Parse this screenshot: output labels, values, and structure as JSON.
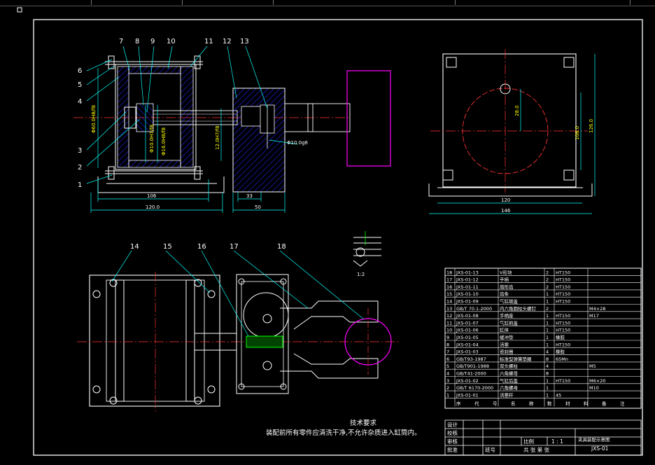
{
  "views": {
    "front_labels": [
      "1",
      "2",
      "3",
      "4",
      "5",
      "6",
      "7",
      "8",
      "9",
      "10",
      "11",
      "12",
      "13"
    ],
    "plan_labels": [
      "14",
      "15",
      "16",
      "17",
      "18"
    ],
    "dims": {
      "d106": "106",
      "d120": "120.0",
      "d33": "33",
      "d50": "50",
      "d120r": "120",
      "d146": "146",
      "d28": "28.0",
      "d108": "108.0",
      "d126": "126.0",
      "phi10g6": "Φ10.0g6",
      "phi60": "Φ60.0H8/f8",
      "phi10h7": "Φ10.0H7/f8",
      "phi16h8": "Φ16.0H8/f8",
      "d12h7": "12.0H7/f8"
    },
    "detail_scale": "1:2"
  },
  "bom": {
    "rows": [
      {
        "no": "18",
        "code": "JXS-01-13",
        "name": "V形块",
        "qty": "2",
        "mat": "HT150",
        "note": ""
      },
      {
        "no": "17",
        "code": "JXS-01-12",
        "name": "手柄",
        "qty": "2",
        "mat": "HT150",
        "note": ""
      },
      {
        "no": "16",
        "code": "JXS-01-11",
        "name": "扇形齿",
        "qty": "2",
        "mat": "HT150",
        "note": ""
      },
      {
        "no": "15",
        "code": "JXS-01-10",
        "name": "齿条",
        "qty": "1",
        "mat": "HT150",
        "note": ""
      },
      {
        "no": "14",
        "code": "JXS-01-09",
        "name": "气缸端盖",
        "qty": "1",
        "mat": "HT150",
        "note": ""
      },
      {
        "no": "13",
        "code": "GB/T 70.1-2000",
        "name": "内六角圆柱头螺钉",
        "qty": "2",
        "mat": "",
        "note": "M4×28"
      },
      {
        "no": "12",
        "code": "JXS-01-08",
        "name": "手柄座",
        "qty": "1",
        "mat": "HT150",
        "note": "M17"
      },
      {
        "no": "11",
        "code": "JXS-01-07",
        "name": "气缸前盖",
        "qty": "1",
        "mat": "HT150",
        "note": ""
      },
      {
        "no": "10",
        "code": "JXS-01-06",
        "name": "缸体",
        "qty": "1",
        "mat": "HT150",
        "note": ""
      },
      {
        "no": "9",
        "code": "JXS-01-05",
        "name": "缓冲垫",
        "qty": "1",
        "mat": "橡胶",
        "note": ""
      },
      {
        "no": "8",
        "code": "JXS-01-04",
        "name": "活塞",
        "qty": "1",
        "mat": "HT150",
        "note": ""
      },
      {
        "no": "7",
        "code": "JXS-01-03",
        "name": "密封圈",
        "qty": "4",
        "mat": "橡胶",
        "note": ""
      },
      {
        "no": "6",
        "code": "GB/T93-1987",
        "name": "标准型弹簧垫圈",
        "qty": "8",
        "mat": "65Mn",
        "note": ""
      },
      {
        "no": "5",
        "code": "GB/T901-1988",
        "name": "双头螺柱",
        "qty": "4",
        "mat": "",
        "note": "M5"
      },
      {
        "no": "4",
        "code": "GB/T41-2000",
        "name": "六角螺母",
        "qty": "8",
        "mat": "",
        "note": ""
      },
      {
        "no": "3",
        "code": "JXS-01-02",
        "name": "气缸后盖",
        "qty": "1",
        "mat": "HT150",
        "note": "M6×20"
      },
      {
        "no": "2",
        "code": "GB/T 6170-2000",
        "name": "六角螺母",
        "qty": "1",
        "mat": "",
        "note": "M10"
      },
      {
        "no": "1",
        "code": "JXS-01-01",
        "name": "活塞杆",
        "qty": "1",
        "mat": "45",
        "note": ""
      }
    ],
    "header_glyphs": [
      "序",
      "代",
      "号",
      "名",
      "称",
      "数",
      "材",
      "料",
      "备",
      "注"
    ]
  },
  "notes": {
    "title": "技术要求",
    "line1": "装配前所有零件应清洗干净,不允许杂质进入缸筒内。"
  },
  "titleblock": {
    "design": "设计",
    "check": "校核",
    "review": "审核",
    "approve": "批准",
    "scale_label": "比例",
    "scale_value": "1 : 1",
    "drawing_name": "夹具装配示意图",
    "drawing_no": "JXS-01",
    "sheets": "共  张  第  张",
    "school": "班号"
  },
  "colors": {
    "bg": "#000000",
    "outline": "#ffffff",
    "center": "#ff0000",
    "hatch": "#0000ff",
    "dim": "#00ffff",
    "dimtext": "#ffff00",
    "leader": "#00ffff",
    "magenta": "#ff00ff",
    "green": "#00ff00"
  }
}
